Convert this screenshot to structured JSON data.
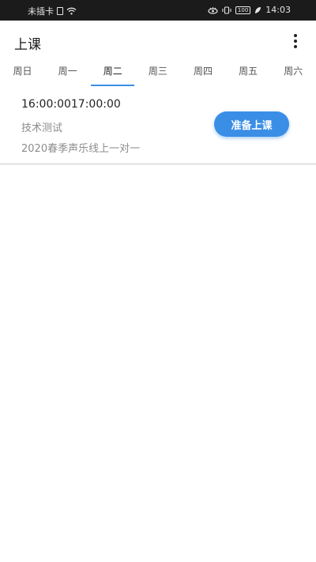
{
  "status_bar": {
    "carrier": "未插卡",
    "battery": "100",
    "time": "14:03"
  },
  "app_bar": {
    "title": "上课",
    "menu_icon": "more-vert-icon"
  },
  "tabs": [
    {
      "label": "周日",
      "active": false
    },
    {
      "label": "周一",
      "active": false
    },
    {
      "label": "周二",
      "active": true
    },
    {
      "label": "周三",
      "active": false
    },
    {
      "label": "周四",
      "active": false
    },
    {
      "label": "周五",
      "active": false
    },
    {
      "label": "周六",
      "active": false
    }
  ],
  "lessons": [
    {
      "time": "16:00:0017:00:00",
      "course": "技术测试",
      "class_name": "2020春季声乐线上一对一",
      "action_label": "准备上课"
    }
  ],
  "colors": {
    "accent": "#3a8ee6",
    "status_bar_bg": "#1b1b1b"
  }
}
